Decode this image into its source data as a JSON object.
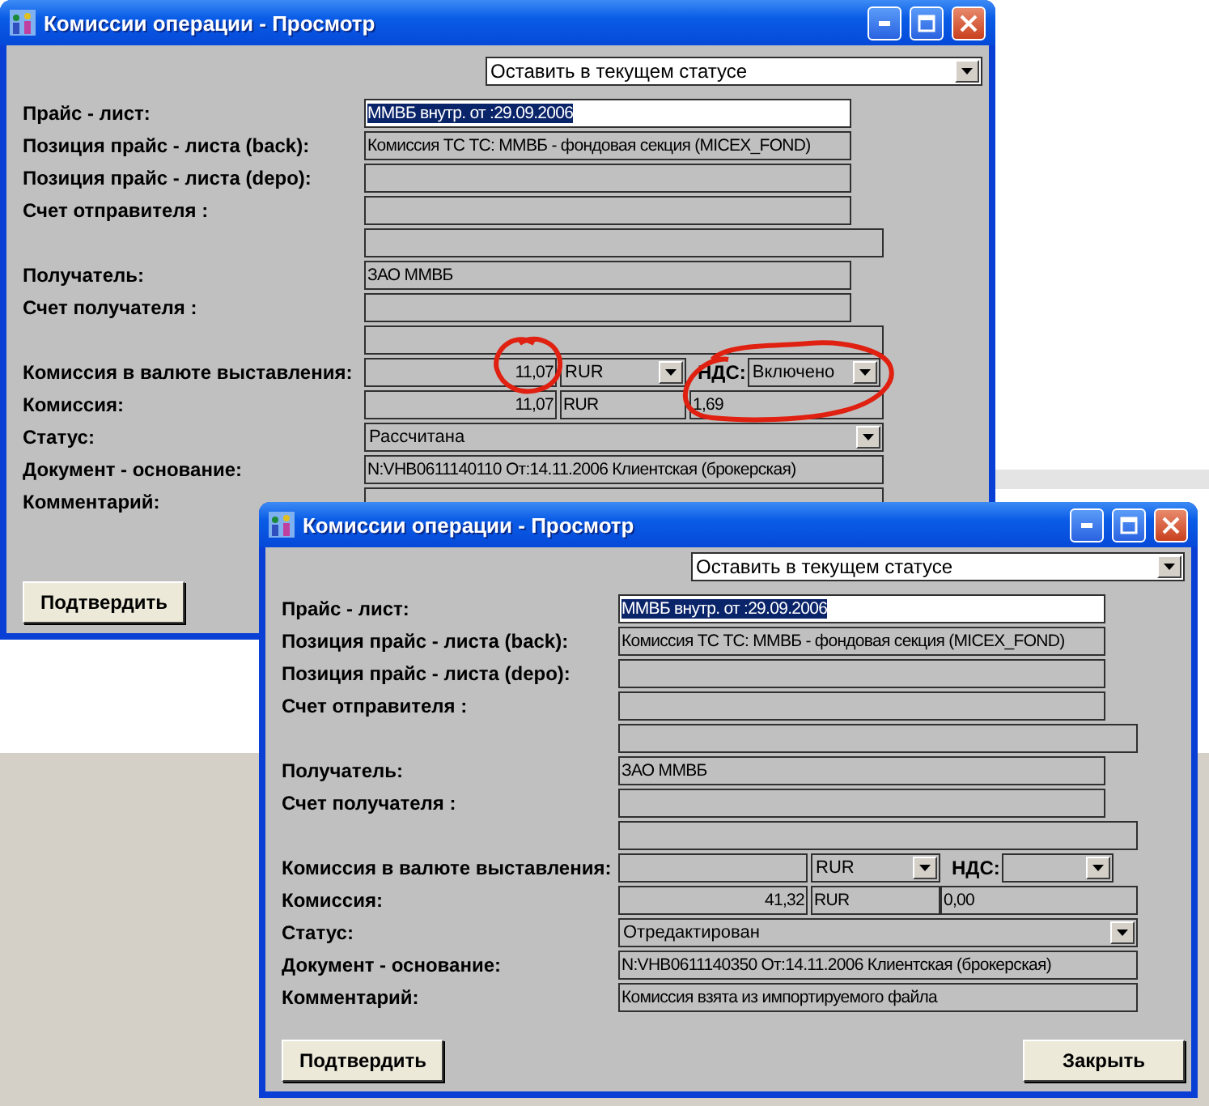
{
  "windows": [
    {
      "title": "Комиссии операции - Просмотр",
      "status_action": "Оставить в текущем статусе",
      "fields": [
        {
          "kind": "text",
          "label": "Прайс - лист:",
          "value": "ММВБ внутр. от :29.09.2006",
          "selected": true
        },
        {
          "kind": "text",
          "label": "Позиция прайс - листа (back):",
          "value": "Комиссия ТС ТС: ММВБ - фондовая секция (MICEX_FOND)"
        },
        {
          "kind": "text",
          "label": "Позиция прайс - листа (depo):"
        },
        {
          "kind": "text",
          "label": "Счет отправителя :"
        },
        {
          "kind": "wide"
        },
        {
          "kind": "text",
          "label": "Получатель:",
          "value": "ЗАО ММВБ"
        },
        {
          "kind": "text",
          "label": "Счет получателя :"
        },
        {
          "kind": "wide"
        },
        {
          "kind": "commission",
          "label": "Комиссия в валюте выставления:",
          "amount": "11,07",
          "currency": "RUR",
          "vat_label": "НДС:",
          "vat": "Включено"
        },
        {
          "kind": "sum",
          "label": "Комиссия:",
          "amount": "11,07",
          "currency": "RUR",
          "vat": "1,69"
        },
        {
          "kind": "select",
          "label": "Статус:",
          "value": "Рассчитана"
        },
        {
          "kind": "long",
          "label": "Документ - основание:",
          "value": "N:VHB0611140110  От:14.11.2006  Клиентская (брокерская)"
        },
        {
          "kind": "long",
          "label": "Комментарий:"
        }
      ],
      "buttons": [
        {
          "kind": "confirm",
          "label": "Подтвердить"
        }
      ]
    },
    {
      "title": "Комиссии операции - Просмотр",
      "status_action": "Оставить в текущем статусе",
      "fields": [
        {
          "kind": "text",
          "label": "Прайс - лист:",
          "value": "ММВБ внутр. от :29.09.2006",
          "selected": true
        },
        {
          "kind": "text",
          "label": "Позиция прайс - листа (back):",
          "value": "Комиссия ТС ТС: ММВБ - фондовая секция (MICEX_FOND)"
        },
        {
          "kind": "text",
          "label": "Позиция прайс - листа (depo):"
        },
        {
          "kind": "text",
          "label": "Счет отправителя :"
        },
        {
          "kind": "wide"
        },
        {
          "kind": "text",
          "label": "Получатель:",
          "value": "ЗАО ММВБ"
        },
        {
          "kind": "text",
          "label": "Счет получателя :"
        },
        {
          "kind": "wide"
        },
        {
          "kind": "commission",
          "label": "Комиссия в валюте выставления:",
          "currency": "RUR",
          "vat_label": "НДС:"
        },
        {
          "kind": "sum",
          "label": "Комиссия:",
          "amount": "41,32",
          "currency": "RUR",
          "vat": "0,00"
        },
        {
          "kind": "select",
          "label": "Статус:",
          "value": "Отредактирован"
        },
        {
          "kind": "long",
          "label": "Документ - основание:",
          "value": "N:VHB0611140350  От:14.11.2006  Клиентская (брокерская)"
        },
        {
          "kind": "long",
          "label": "Комментарий:",
          "value": "Комиссия взята из импортируемого файла"
        }
      ],
      "buttons": [
        {
          "kind": "confirm",
          "label": "Подтвердить"
        },
        {
          "kind": "close",
          "label": "Закрыть"
        }
      ]
    }
  ]
}
